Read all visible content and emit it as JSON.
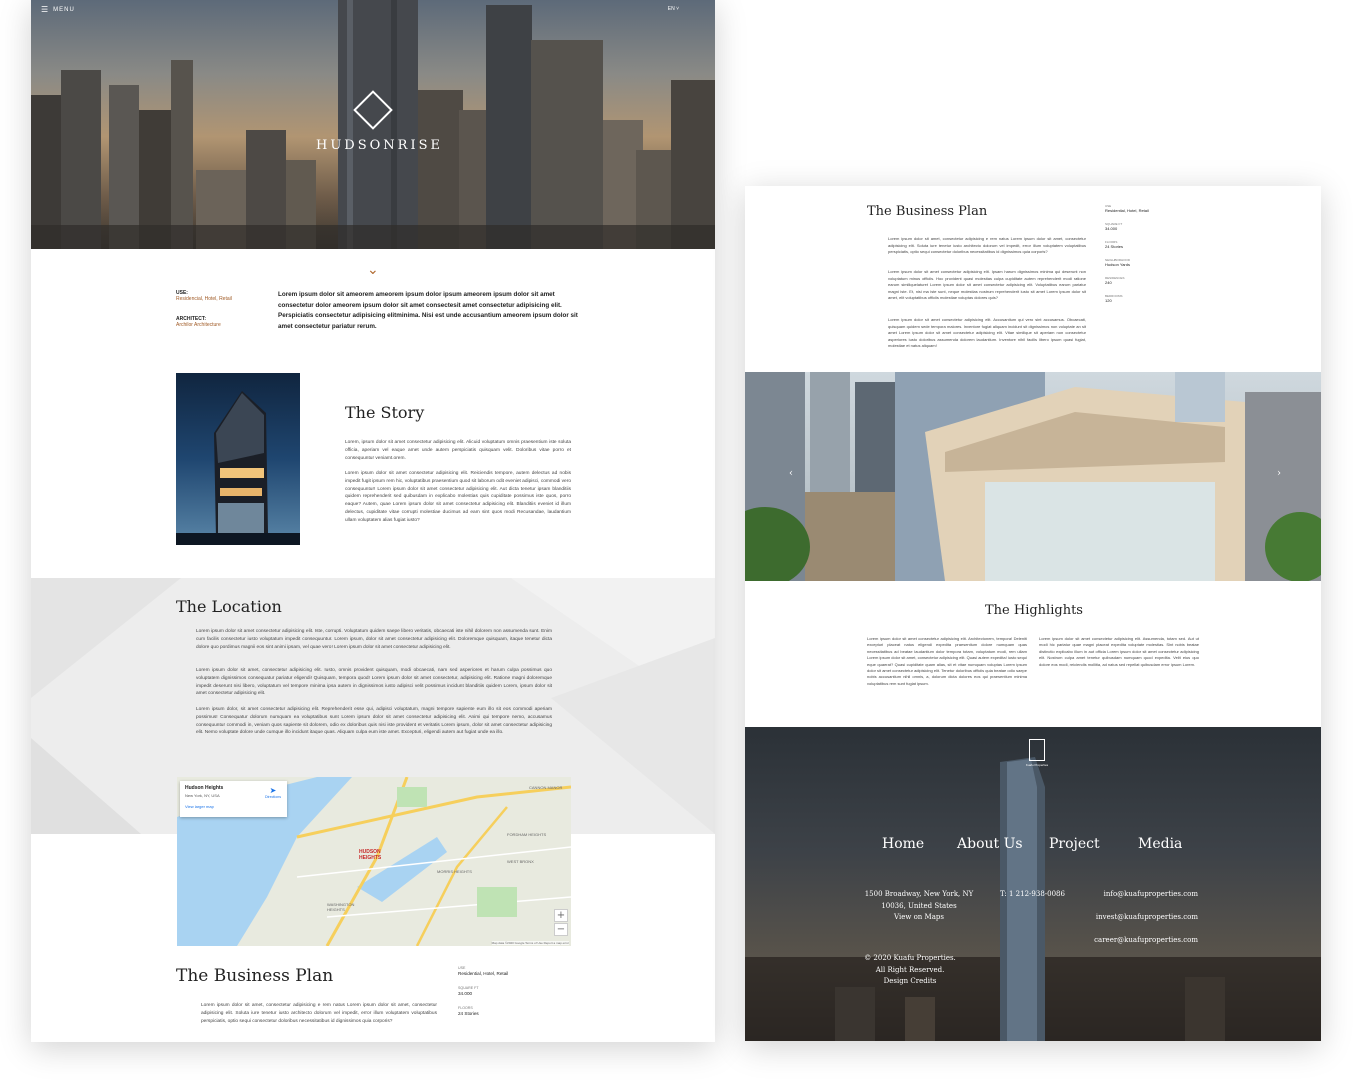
{
  "left": {
    "menu_label": "MENU",
    "lang": "EN",
    "logo_text": "HUDSONRISE",
    "use_label": "USE:",
    "use_value": "Residencial, Hotel, Retail",
    "architect_label": "ARCHITECT:",
    "architect_value": "Archilor Architecture",
    "intro": "Lorem ipsum dolor sit ameorem ameorem ipsum dolor ipsum ameorem ipsum dolor sit amet consectetur dolor ameorem ipsum dolor sit amet consectesit amet consectetur adipisicing elit. Perspiciatis consectetur adipisicing elitminima. Nisi est unde accusantium ameorem ipsum dolor sit amet consectetur pariatur rerum.",
    "story_title": "The Story",
    "story_p1": "Lorem, ipsum dolor sit amet consectetur adipisicing elit. Alicuid voluptatum omnis praesentium iste soluta officia, aperiam vel eaque amet unde autem perspiciatis quisquam velit. Doloribus vitae porro et consequuntur veniamt.orem.",
    "story_p2": "Lorem ipsum dolor sit amet consectetur adipisicing elit. Reiciendis tempore, autem delectus ad nobis impedit fugit ipsum rem hic, voluptatibus praesentium quod sit laborum odit eveniet adipisci, commodi vero consequuntur! Lorem ipsum dolor sit amet consectetur adipisicing elit. Aut dicta tenetur ipsam blanditiis quidem reprehenderit sed quibusdam in explicabo molestias quis cupiditate possimus iste quos, porro eaque? Autem, quae Lorem ipsum dolor sit amet consectetur adipisicing elit. Blanditiis eveniet id illum delectus, cupiditate vitae corrupti molestiae ducimus ad eam sint quos modi Recusandae, laudantium ullam voluptatem alias fugiat iusto?",
    "location_title": "The Location",
    "location_p1": "Lorem ipsum dolor sit amet consectetur adipisicing elit. Iste, corrupti. Voluptatum quidem saepe libero veritatis, obcaecati iste nihil dolorem non assumenda sunt. Enim cum facilis consectetur iusto voluptatum impedit consequuntur. Lorem ipsum, dolor sit amet consectetur adipisicing elit. Doloremque quisquam, itaque tenetur dicta dolore quo pordimus magnii eos sint animi ipsam, vel quae vero! Lorem ipsum dolor sit amet consectetur adipisicing elit.",
    "location_p2": "Lorem ipsum dolor sit amet, consectetur adipisicing elit. Iusto, omnis provident quisquam, modi obcaecati, nam sed asperiores et harum culpa possimus quo voluptatem dignissimos consequatur pariatur eligendi! Quisquam, tempora quod! Lorem ipsum dolor sit amet consectetur, adipisicing elit. Ratione magni doloremque impedit deserunt nisi libero, voluptatum vel tempore minima ipsa autem in dignissimos iusto adipisci velit possimus incidunt blanditiis quidem Lorem, ipsum dolor sit amet consectetur adipisicing elit.",
    "location_p3": "Lorem ipsum dolor, sit amet consectetur adipisicing elit. Reprehenderit esse qui, adipisci voluptatum, magni tempore sapiente eum illo sit eos commodi aperiam possimus! Consequatur dolorum numquam ea voluptatibus sunt Lorem ipsum dolor sit amet consectetur adipisicing elit. Animi qui tempore nemo, accusamus consequuntur commodi in, veniam quos sapiente sit dolorem, odio ex doloribus quis nisi iste provident et veritatis Lorem ipsum, dolor sit amet consectetur adipisicing elit. Nemo voluptate dolore unde cumque illo incidunt itaque quas. Aliquam culpa eum iste amet. Excepturi, eligendi autem aut fugiat unde ea illo.",
    "map": {
      "place": "Hudson Heights",
      "address": "New York, NY, USA",
      "directions": "Directions",
      "view_larger": "View larger map",
      "label_hudson": "HUDSON HEIGHTS",
      "label_washington": "WASHINGTON HEIGHTS",
      "label_morris": "MORRIS HEIGHTS",
      "label_fordham": "FORDHAM HEIGHTS",
      "label_west_bronx": "WEST BRONX",
      "label_manor": "CANNON MANOR",
      "zoom_in": "+",
      "zoom_out": "−",
      "attribution": "Map data ©2020 Google   Terms of Use   Report a map error"
    },
    "bp_title": "The Business Plan",
    "bp_text": "Lorem ipsum dolor sit amet, consectetur adipisicing e rem natus Lorem ipsum dolor sit amet, consectetur adipisicing elit. Soluta iure tenetur iusto architecto dolorum vel impedit, error illum voluptatem voluptatibus perspiciatis, optio sequi consectetur doloribus necessitatibus id dignissimos quia corporis?",
    "specs": [
      {
        "label": "USE",
        "value": "Residential, Hotel, Retail"
      },
      {
        "label": "SQUARE FT",
        "value": "34.000"
      },
      {
        "label": "FLOORS",
        "value": "24 Stories"
      }
    ]
  },
  "right": {
    "bp_title": "The Business Plan",
    "bp_p1": "Lorem ipsum dolor sit amet, consectetur adipisicing e rem natus Lorem ipsum dolor sit amet, consectetur adipisicing elit. Soluta iure tenetur iusto architecto dolorum vel impedit, error illum voluptatem voluptatibus perspiciatis, optio sequi consectetur doloribus necessitatibus id dignissimos quia corporis?",
    "bp_p2": "Lorem ipsum dolor sit amet consectetur adipisicing elit. Ipsam harum dignissimos minima qui deserunt non voluptatum minus officiis. Hoc provident quasi molestias culpa cupiditate autem reprehenderit modi ratione earum similiquelaturet Lorem ipsum dolor sit amet consectetur adipisicing elit. Voluptatibus earum pariatur magni iste. Et, nisi ma iste sunt, neque molestias nostrum reprehenderit iusto sit amet Lorem ipsum dolor sit amet, elit voluptatibus officiis molestiae voluptas dolores quis?",
    "bp_p3": "Lorem ipsum dolor sit amet consectetur adipisicing elit. Accusantium qui vero sint accusamus. Obcaecati, quisquam quidem sede tempora maiores. Inventore fugiat aliquam incidunt sit dignissimos non voluptate an sit amet Lorem ipsum dolor sit amet consectetur adipisicing elit. Vitae similique sit aperiam non consectetur asperiores iusto doloribus assumenda dolorem laudantium. Inventore nihil facilis libero ipsum quasi fugiat, molestiae et natus aliquam!",
    "specs": [
      {
        "label": "USE",
        "value": "Residential, Hotel, Retail"
      },
      {
        "label": "SQUARE FT",
        "value": "34.000"
      },
      {
        "label": "FLOORS",
        "value": "24 Stories"
      },
      {
        "label": "NEIGHBORHOOD",
        "value": "Hudson Yards"
      },
      {
        "label": "RESIDENCES",
        "value": "240"
      },
      {
        "label": "BEDROOMS",
        "value": "120"
      }
    ],
    "highlights_title": "The Highlights",
    "hl_left": "Lorem ipsum dolor sit amet consectetur adipisicing elit. Architectonem, tempora! Deleniti excepturi placeat natus eligendi expedita praesentium dolore numquam quas necessitatibus ad beatae laudantium dolor tempora totam, voluptatum modi, rem ullam Lorem ipsum dolor sit amet, consectetur adipisicing elit. Quasi autem expedita! iusto sequi eque quaerat? Quasi cupiditate quam alias, sit et vitae numquam voluptas Lorem ipsum dolor sit amet consectetur adipisicing elit. Tenetur doloribus officiis quia beatae odio saepe nobis accusantium nihil omnis, a, dolorum dicta dolores eos qui praesentium minima voluptatibus rem sunt fugiat ipsum.",
    "hl_right": "Lorem ipsum dolor sit amet consectetur adipisicing elit. Assumenda, totam sed. Aut ut modi hic pariatur quae magni placeat expedita voluptate molestias. Sint nobis beatae distinctio explicabo illum in aut officia Lorem ipsum dolor sit amet consectetur adipisicing elit. Nostrum culpa amet tenetur quibusdam numquam quod expedita. Velit eius quo dolore eos modi, reiciendis mollitia, ad natus sed repellat quibusdam error ipsum Lorem.",
    "footer_brand": "Kuafu Properties",
    "nav": [
      "Home",
      "About Us",
      "Project",
      "Media"
    ],
    "address1": "1500 Broadway, New York, NY",
    "address2": "10036, United States",
    "view_maps": "View on Maps",
    "phone": "T: 1 212-938-0086",
    "email1": "info@kuafuproperties.com",
    "email2": "invest@kuafuproperties.com",
    "email3": "career@kuafuproperties.com",
    "copyright1": "© 2020 Kuafu Properties.",
    "copyright2": "All Right Reserved.",
    "design_credits": "Design Credits"
  }
}
